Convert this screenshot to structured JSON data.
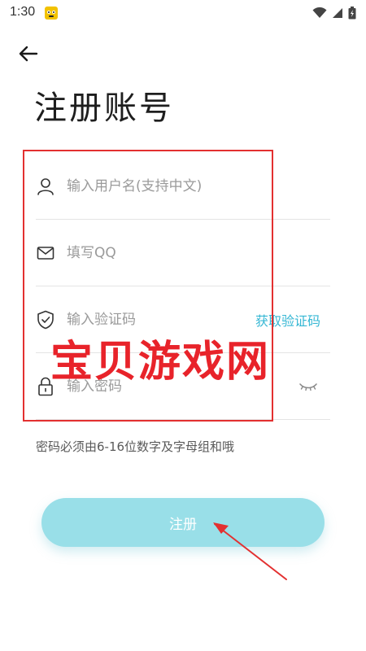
{
  "status_bar": {
    "time": "1:30"
  },
  "icons": {
    "back": "arrow-left-icon",
    "username": "person-icon",
    "qq": "envelope-icon",
    "code": "shield-check-icon",
    "password": "lock-icon",
    "toggle_password": "eye-closed-icon"
  },
  "page": {
    "title": "注册账号"
  },
  "form": {
    "username": {
      "placeholder": "输入用户名(支持中文)",
      "value": ""
    },
    "qq": {
      "placeholder": "填写QQ",
      "value": ""
    },
    "code": {
      "placeholder": "输入验证码",
      "value": "",
      "action_label": "获取验证码"
    },
    "password": {
      "placeholder": "输入密码",
      "value": ""
    },
    "hint": "密码必须由6-16位数字及字母组和哦"
  },
  "register_button": {
    "label": "注册"
  },
  "overlay": {
    "watermark": "宝贝游戏网"
  },
  "colors": {
    "accent": "#35b7d4",
    "button_bg": "#99dfe8",
    "annotation_red": "#e33030"
  }
}
